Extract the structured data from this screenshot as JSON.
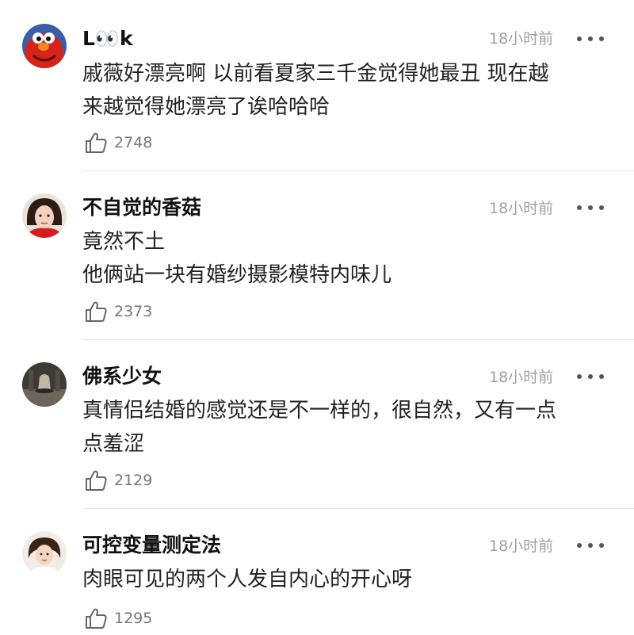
{
  "comments": [
    {
      "username": "L👀k",
      "time": "18小时前",
      "lines": [
        "戚薇好漂亮啊 以前看夏家三千金觉得她最丑 现在越",
        "来越觉得她漂亮了诶哈哈哈"
      ],
      "likes": "2748"
    },
    {
      "username": "不自觉的香菇",
      "time": "18小时前",
      "lines": [
        "竟然不土",
        "他俩站一块有婚纱摄影模特内味儿"
      ],
      "likes": "2373"
    },
    {
      "username": "佛系少女",
      "time": "18小时前",
      "lines": [
        "真情侣结婚的感觉还是不一样的，很自然，又有一点",
        "点羞涩"
      ],
      "likes": "2129"
    },
    {
      "username": "可控变量测定法",
      "time": "18小时前",
      "lines": [
        "肉眼可见的两个人发自内心的开心呀"
      ],
      "likes": "1295"
    }
  ],
  "icons": {
    "like": "thumbs-up-icon",
    "more": "more-dots-icon"
  }
}
